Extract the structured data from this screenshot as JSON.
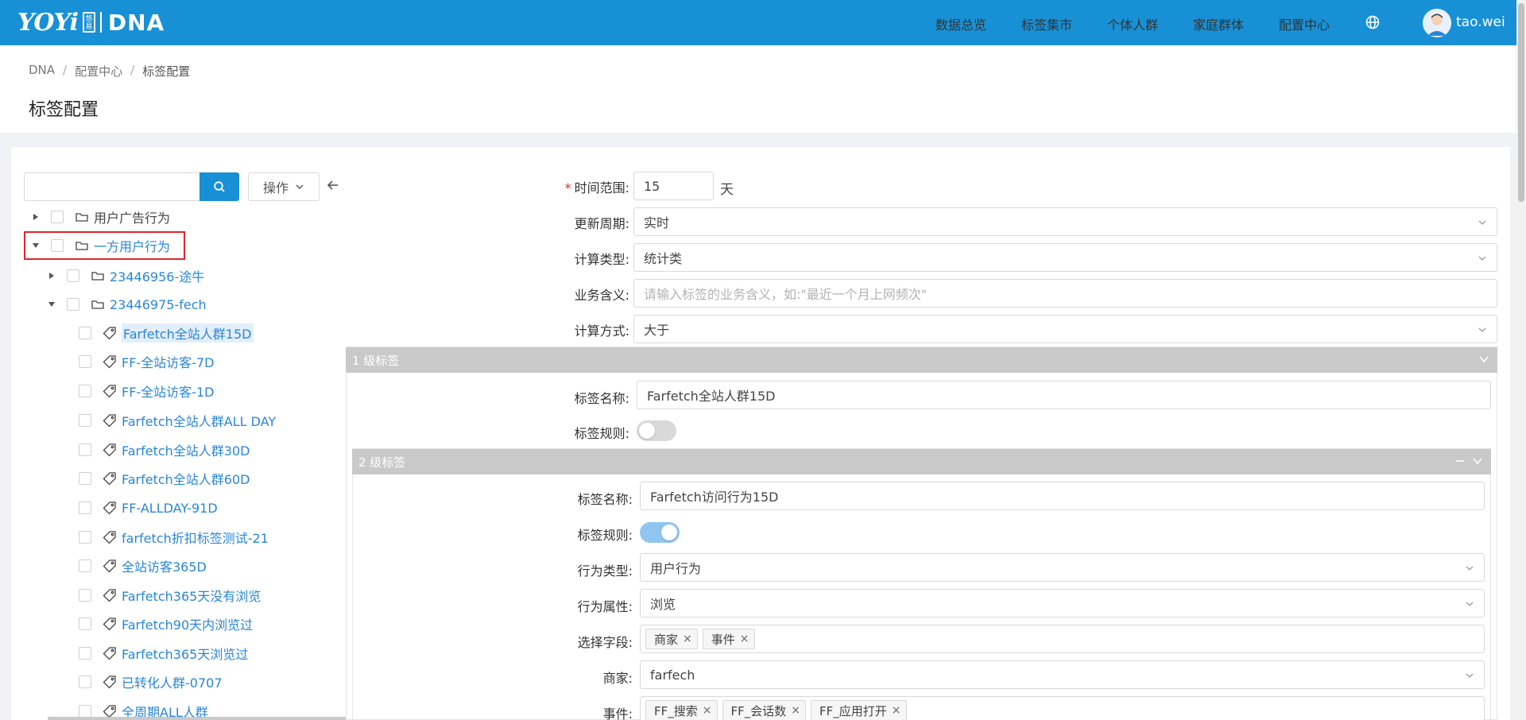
{
  "header": {
    "logo_yoyi": "YOYi",
    "logo_badge": "悠易",
    "logo_dna": "DNA",
    "nav": [
      "数据总览",
      "标签集市",
      "个体人群",
      "家庭群体",
      "配置中心"
    ],
    "user": "tao.wei"
  },
  "breadcrumb": [
    "DNA",
    "配置中心",
    "标签配置"
  ],
  "page_title": "标签配置",
  "left": {
    "search_placeholder": "",
    "ops_label": "操作",
    "tree": [
      {
        "label": "用户广告行为",
        "type": "folder",
        "level": 0,
        "expanded": false
      },
      {
        "label": "一方用户行为",
        "type": "folder",
        "level": 0,
        "expanded": true
      },
      {
        "label": "23446956-途牛",
        "type": "folder",
        "level": 1,
        "expanded": false
      },
      {
        "label": "23446975-fech",
        "type": "folder",
        "level": 1,
        "expanded": true
      },
      {
        "label": "Farfetch全站人群15D",
        "type": "tag",
        "level": 2,
        "selected": true
      },
      {
        "label": "FF-全站访客-7D",
        "type": "tag",
        "level": 2
      },
      {
        "label": "FF-全站访客-1D",
        "type": "tag",
        "level": 2
      },
      {
        "label": "Farfetch全站人群ALL DAY",
        "type": "tag",
        "level": 2
      },
      {
        "label": "Farfetch全站人群30D",
        "type": "tag",
        "level": 2
      },
      {
        "label": "Farfetch全站人群60D",
        "type": "tag",
        "level": 2
      },
      {
        "label": "FF-ALLDAY-91D",
        "type": "tag",
        "level": 2
      },
      {
        "label": "farfetch折扣标签测试-21",
        "type": "tag",
        "level": 2
      },
      {
        "label": "全站访客365D",
        "type": "tag",
        "level": 2
      },
      {
        "label": "Farfetch365天没有浏览",
        "type": "tag",
        "level": 2
      },
      {
        "label": "Farfetch90天内浏览过",
        "type": "tag",
        "level": 2
      },
      {
        "label": "Farfetch365天浏览过",
        "type": "tag",
        "level": 2
      },
      {
        "label": "已转化人群-0707",
        "type": "tag",
        "level": 2
      },
      {
        "label": "全周期ALL人群",
        "type": "tag",
        "level": 2
      }
    ]
  },
  "form": {
    "time_range_label": "时间范围:",
    "time_range_value": "15",
    "time_range_unit": "天",
    "update_cycle_label": "更新周期:",
    "update_cycle_value": "实时",
    "calc_type_label": "计算类型:",
    "calc_type_value": "统计类",
    "business_label": "业务含义:",
    "business_placeholder": "请输入标签的业务含义，如:\"最近一个月上网频次\"",
    "calc_method_label": "计算方式:",
    "calc_method_value": "大于",
    "level1": {
      "title": "1 级标签",
      "name_label": "标签名称:",
      "name_value": "Farfetch全站人群15D",
      "rule_label": "标签规则:"
    },
    "level2": {
      "title": "2 级标签",
      "name_label": "标签名称:",
      "name_value": "Farfetch访问行为15D",
      "rule_label": "标签规则:",
      "behavior_type_label": "行为类型:",
      "behavior_type_value": "用户行为",
      "behavior_attr_label": "行为属性:",
      "behavior_attr_value": "浏览",
      "fields_label": "选择字段:",
      "fields": [
        "商家",
        "事件"
      ],
      "merchant_label": "商家:",
      "merchant_value": "farfech",
      "event_label": "事件:",
      "events": [
        "FF_搜索",
        "FF_会话数",
        "FF_应用打开"
      ]
    }
  },
  "colors": {
    "primary": "#1890d5",
    "link": "#2a86d6",
    "section_bar": "#c9c9c9",
    "highlight_border": "#e0262b"
  }
}
